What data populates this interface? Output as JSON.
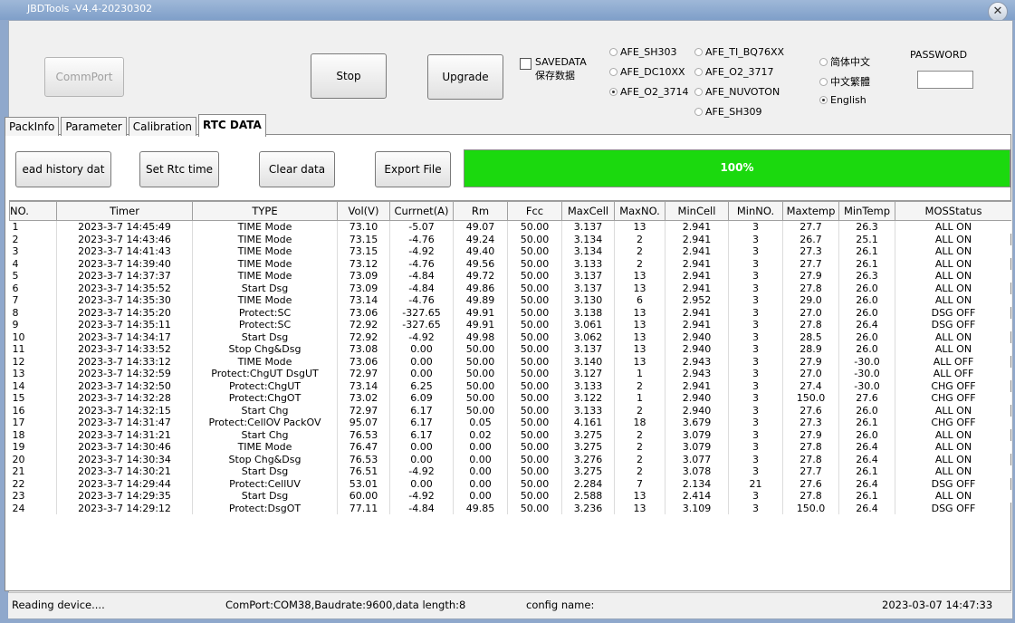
{
  "window": {
    "title": "JBDTools -V4.4-20230302"
  },
  "toolbar": {
    "commport_label": "CommPort",
    "stop_label": "Stop",
    "upgrade_label": "Upgrade",
    "savedata_label": "SAVEDATA",
    "savedata_label2": "保存数据",
    "savedata_checked": false
  },
  "afe_options": [
    {
      "label": "AFE_SH303",
      "selected": false
    },
    {
      "label": "AFE_DC10XX",
      "selected": false
    },
    {
      "label": "AFE_O2_3714",
      "selected": true
    },
    {
      "label": "AFE_TI_BQ76XX",
      "selected": false
    },
    {
      "label": "AFE_O2_3717",
      "selected": false
    },
    {
      "label": "AFE_NUVOTON",
      "selected": false
    },
    {
      "label": "AFE_SH309",
      "selected": false
    }
  ],
  "language_options": [
    {
      "label": "简体中文",
      "selected": false
    },
    {
      "label": "中文繁體",
      "selected": false
    },
    {
      "label": "English",
      "selected": true
    }
  ],
  "password": {
    "label": "PASSWORD",
    "value": ""
  },
  "tabs": [
    {
      "label": "PackInfo",
      "active": false
    },
    {
      "label": "Parameter",
      "active": false
    },
    {
      "label": "Calibration",
      "active": false
    },
    {
      "label": "RTC DATA",
      "active": true
    }
  ],
  "actions": {
    "read_history_label": "ead history dat",
    "set_rtc_label": "Set Rtc time",
    "clear_label": "Clear data",
    "export_label": "Export File"
  },
  "progress": {
    "value": 100,
    "label": "100%",
    "color": "#1bd90e"
  },
  "table": {
    "columns": [
      "NO.",
      "Timer",
      "TYPE",
      "Vol(V)",
      "Currnet(A)",
      "Rm",
      "Fcc",
      "MaxCell",
      "MaxNO.",
      "MinCell",
      "MinNO.",
      "Maxtemp",
      "MinTemp",
      "MOSStatus"
    ],
    "rows": [
      [
        "1",
        "2023-3-7 14:45:49",
        "TIME Mode",
        "73.10",
        "-5.07",
        "49.07",
        "50.00",
        "3.137",
        "13",
        "2.941",
        "3",
        "27.7",
        "26.3",
        "ALL ON"
      ],
      [
        "2",
        "2023-3-7 14:43:46",
        "TIME Mode",
        "73.15",
        "-4.76",
        "49.24",
        "50.00",
        "3.134",
        "2",
        "2.941",
        "3",
        "26.7",
        "25.1",
        "ALL ON"
      ],
      [
        "3",
        "2023-3-7 14:41:43",
        "TIME Mode",
        "73.15",
        "-4.92",
        "49.40",
        "50.00",
        "3.134",
        "2",
        "2.941",
        "3",
        "27.3",
        "26.1",
        "ALL ON"
      ],
      [
        "4",
        "2023-3-7 14:39:40",
        "TIME Mode",
        "73.12",
        "-4.76",
        "49.56",
        "50.00",
        "3.133",
        "2",
        "2.941",
        "3",
        "27.7",
        "26.1",
        "ALL ON"
      ],
      [
        "5",
        "2023-3-7 14:37:37",
        "TIME Mode",
        "73.09",
        "-4.84",
        "49.72",
        "50.00",
        "3.137",
        "13",
        "2.941",
        "3",
        "27.9",
        "26.3",
        "ALL ON"
      ],
      [
        "6",
        "2023-3-7 14:35:52",
        "Start Dsg",
        "73.09",
        "-4.84",
        "49.86",
        "50.00",
        "3.137",
        "13",
        "2.941",
        "3",
        "27.8",
        "26.0",
        "ALL ON"
      ],
      [
        "7",
        "2023-3-7 14:35:30",
        "TIME Mode",
        "73.14",
        "-4.76",
        "49.89",
        "50.00",
        "3.130",
        "6",
        "2.952",
        "3",
        "29.0",
        "26.0",
        "ALL ON"
      ],
      [
        "8",
        "2023-3-7 14:35:20",
        "Protect:SC",
        "73.06",
        "-327.65",
        "49.91",
        "50.00",
        "3.138",
        "13",
        "2.941",
        "3",
        "27.0",
        "26.0",
        "DSG OFF"
      ],
      [
        "9",
        "2023-3-7 14:35:11",
        "Protect:SC",
        "72.92",
        "-327.65",
        "49.91",
        "50.00",
        "3.061",
        "13",
        "2.941",
        "3",
        "27.8",
        "26.4",
        "DSG OFF"
      ],
      [
        "10",
        "2023-3-7 14:34:17",
        "Start Dsg",
        "72.92",
        "-4.92",
        "49.98",
        "50.00",
        "3.062",
        "13",
        "2.940",
        "3",
        "28.5",
        "26.0",
        "ALL ON"
      ],
      [
        "11",
        "2023-3-7 14:33:52",
        "Stop Chg&Dsg",
        "73.08",
        "0.00",
        "50.00",
        "50.00",
        "3.137",
        "13",
        "2.940",
        "3",
        "28.9",
        "26.0",
        "ALL ON"
      ],
      [
        "12",
        "2023-3-7 14:33:12",
        "TIME Mode",
        "73.06",
        "0.00",
        "50.00",
        "50.00",
        "3.140",
        "13",
        "2.943",
        "3",
        "27.9",
        "-30.0",
        "ALL OFF"
      ],
      [
        "13",
        "2023-3-7 14:32:59",
        "Protect:ChgUT  DsgUT",
        "72.97",
        "0.00",
        "50.00",
        "50.00",
        "3.127",
        "1",
        "2.943",
        "3",
        "27.0",
        "-30.0",
        "ALL OFF"
      ],
      [
        "14",
        "2023-3-7 14:32:50",
        "Protect:ChgUT",
        "73.14",
        "6.25",
        "50.00",
        "50.00",
        "3.133",
        "2",
        "2.941",
        "3",
        "27.4",
        "-30.0",
        "CHG OFF"
      ],
      [
        "15",
        "2023-3-7 14:32:28",
        "Protect:ChgOT",
        "73.02",
        "6.09",
        "50.00",
        "50.00",
        "3.122",
        "1",
        "2.940",
        "3",
        "150.0",
        "27.6",
        "CHG OFF"
      ],
      [
        "16",
        "2023-3-7 14:32:15",
        "Start Chg",
        "72.97",
        "6.17",
        "50.00",
        "50.00",
        "3.133",
        "2",
        "2.940",
        "3",
        "27.6",
        "26.0",
        "ALL ON"
      ],
      [
        "17",
        "2023-3-7 14:31:47",
        "Protect:CellOV PackOV",
        "95.07",
        "6.17",
        "0.05",
        "50.00",
        "4.161",
        "18",
        "3.679",
        "3",
        "27.3",
        "26.1",
        "CHG OFF"
      ],
      [
        "18",
        "2023-3-7 14:31:21",
        "Start Chg",
        "76.53",
        "6.17",
        "0.02",
        "50.00",
        "3.275",
        "2",
        "3.079",
        "3",
        "27.9",
        "26.0",
        "ALL ON"
      ],
      [
        "19",
        "2023-3-7 14:30:46",
        "TIME Mode",
        "76.47",
        "0.00",
        "0.00",
        "50.00",
        "3.275",
        "2",
        "3.079",
        "3",
        "27.8",
        "26.4",
        "ALL ON"
      ],
      [
        "20",
        "2023-3-7 14:30:34",
        "Stop Chg&Dsg",
        "76.53",
        "0.00",
        "0.00",
        "50.00",
        "3.276",
        "2",
        "3.077",
        "3",
        "27.8",
        "26.4",
        "ALL ON"
      ],
      [
        "21",
        "2023-3-7 14:30:21",
        "Start Dsg",
        "76.51",
        "-4.92",
        "0.00",
        "50.00",
        "3.275",
        "2",
        "3.078",
        "3",
        "27.7",
        "26.1",
        "ALL ON"
      ],
      [
        "22",
        "2023-3-7 14:29:44",
        "Protect:CellUV",
        "53.01",
        "0.00",
        "0.00",
        "50.00",
        "2.284",
        "7",
        "2.134",
        "21",
        "27.6",
        "26.4",
        "DSG OFF"
      ],
      [
        "23",
        "2023-3-7 14:29:35",
        "Start Dsg",
        "60.00",
        "-4.92",
        "0.00",
        "50.00",
        "2.588",
        "13",
        "2.414",
        "3",
        "27.8",
        "26.1",
        "ALL ON"
      ],
      [
        "24",
        "2023-3-7 14:29:12",
        "Protect:DsgOT",
        "77.11",
        "-4.84",
        "49.85",
        "50.00",
        "3.236",
        "13",
        "3.109",
        "3",
        "150.0",
        "26.4",
        "DSG OFF"
      ]
    ]
  },
  "status": {
    "reading": "Reading device....",
    "comport": "ComPort:COM38,Baudrate:9600,data length:8",
    "config": "config name:",
    "datetime": "2023-03-07 14:47:33"
  }
}
